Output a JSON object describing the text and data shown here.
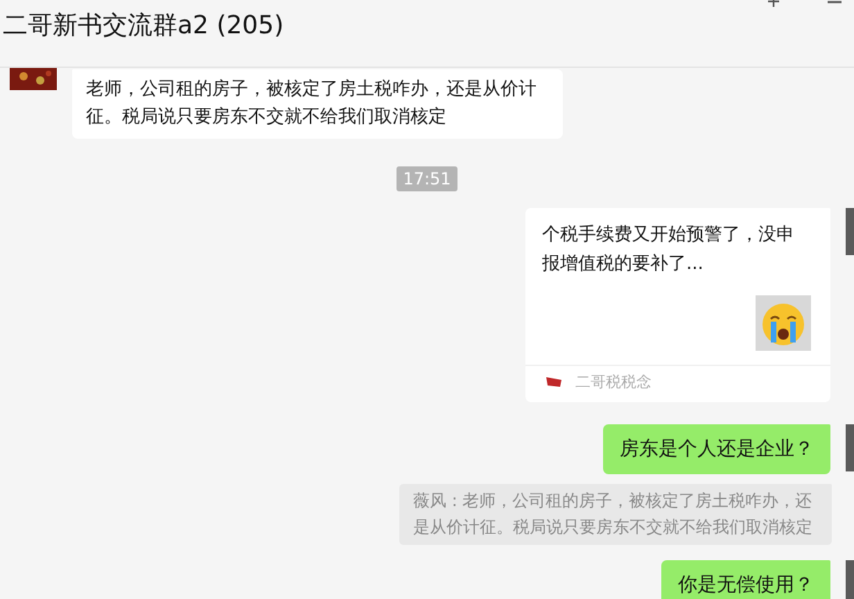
{
  "header": {
    "title": "二哥新书交流群a2 (205)"
  },
  "messages": [
    {
      "kind": "text",
      "outgoing": false,
      "text": "老师，公司租的房子，被核定了房土税咋办，还是从价计征。税局说只要房东不交就不给我们取消核定"
    },
    {
      "kind": "time",
      "text": "17:51"
    },
    {
      "kind": "card",
      "outgoing": true,
      "text": "个税手续费又开始预警了，没申报增值税的要补了...",
      "source": "二哥税税念"
    },
    {
      "kind": "text",
      "outgoing": true,
      "text": "房东是个人还是企业？"
    },
    {
      "kind": "quote",
      "outgoing": true,
      "text": "薇风 : 老师，公司租的房子，被核定了房土税咋办，还是从价计征。税局说只要房东不交就不给我们取消核定"
    },
    {
      "kind": "text",
      "outgoing": true,
      "text": "你是无偿使用？"
    }
  ]
}
